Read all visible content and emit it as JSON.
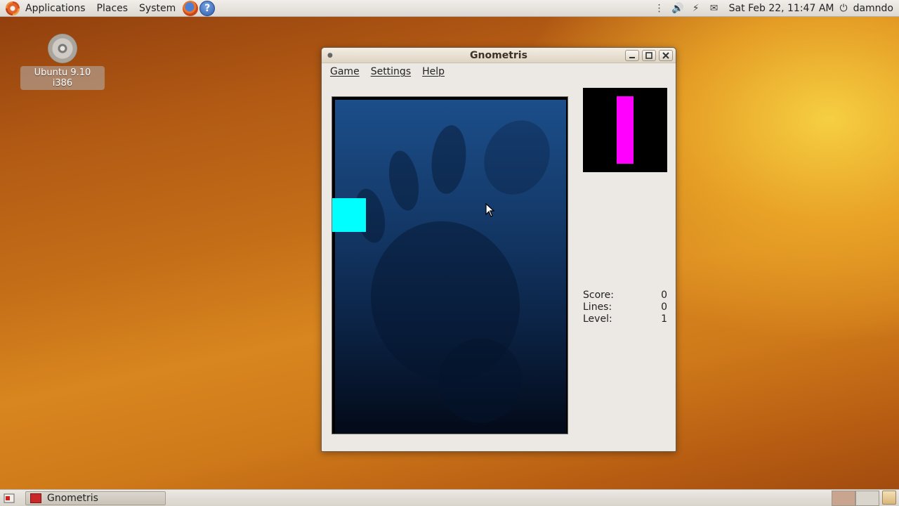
{
  "top_panel": {
    "menus": [
      "Applications",
      "Places",
      "System"
    ],
    "launchers": {
      "help_glyph": "?"
    },
    "clock": "Sat Feb 22, 11:47 AM",
    "username": "damndo"
  },
  "desktop": {
    "icon_label": "Ubuntu 9.10 i386"
  },
  "window": {
    "title": "Gnometris",
    "menus": [
      "Game",
      "Settings",
      "Help"
    ],
    "stats": {
      "score_label": "Score:",
      "score_value": "0",
      "lines_label": "Lines:",
      "lines_value": "0",
      "level_label": "Level:",
      "level_value": "1"
    },
    "colors": {
      "current_block": "#00ffff",
      "next_piece": "#ff00ff"
    }
  },
  "bottom_panel": {
    "task_label": "Gnometris"
  }
}
